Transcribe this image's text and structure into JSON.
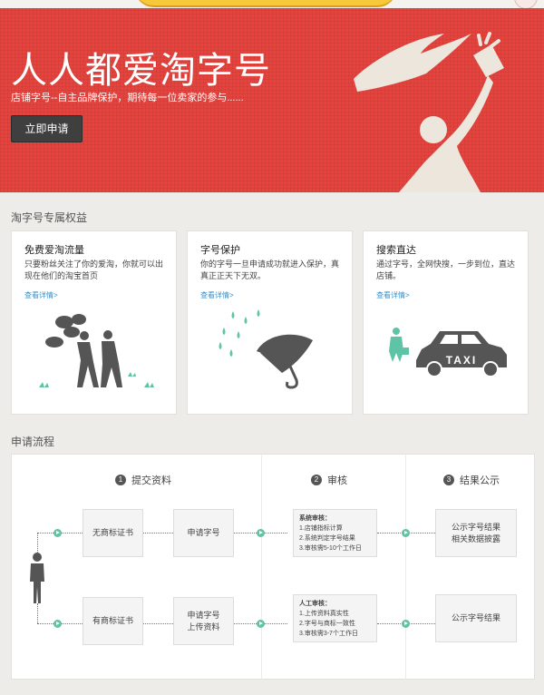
{
  "hero": {
    "title": "人人都爱淘字号",
    "subtitle": "店铺字号--自主品牌保护，期待每一位卖家的参与......",
    "apply_button": "立即申请"
  },
  "benefits": {
    "section_title": "淘字号专属权益",
    "cards": [
      {
        "title": "免费爱淘流量",
        "desc": "只要粉丝关注了你的爱淘，你就可以出现在他们的淘宝首页",
        "link": "查看详情>",
        "illustration": "people-chatting-icon"
      },
      {
        "title": "字号保护",
        "desc": "你的字号一旦申请成功就进入保护，真真正正天下无双。",
        "link": "查看详情>",
        "illustration": "umbrella-rain-icon"
      },
      {
        "title": "搜索直达",
        "desc": "通过字号，全网快搜，一步到位，直达店铺。",
        "link": "查看详情>",
        "illustration": "taxi-icon",
        "taxi_text": "TAXI"
      }
    ]
  },
  "process": {
    "section_title": "申请流程",
    "steps": [
      {
        "num": "1",
        "label": "提交资料"
      },
      {
        "num": "2",
        "label": "审核"
      },
      {
        "num": "3",
        "label": "结果公示"
      }
    ],
    "row1": {
      "trademark": "无商标证书",
      "apply": "申请字号",
      "review_title": "系统审核：",
      "review_items": [
        "1.店铺指标计算",
        "2.系统判定字号结果",
        "3.审核需5-10个工作日"
      ],
      "result_line1": "公示字号结果",
      "result_line2": "相关数据披露"
    },
    "row2": {
      "trademark": "有商标证书",
      "apply_line1": "申请字号",
      "apply_line2": "上传资料",
      "review_title": "人工审核：",
      "review_items": [
        "1.上传资料真实性",
        "2.字号与商标一致性",
        "3.审核需3-7个工作日"
      ],
      "result": "公示字号结果"
    }
  },
  "colors": {
    "hero_red": "#e4433e",
    "accent_teal": "#5fc3a5",
    "link_blue": "#3a8fc7",
    "icon_gray": "#555555"
  }
}
